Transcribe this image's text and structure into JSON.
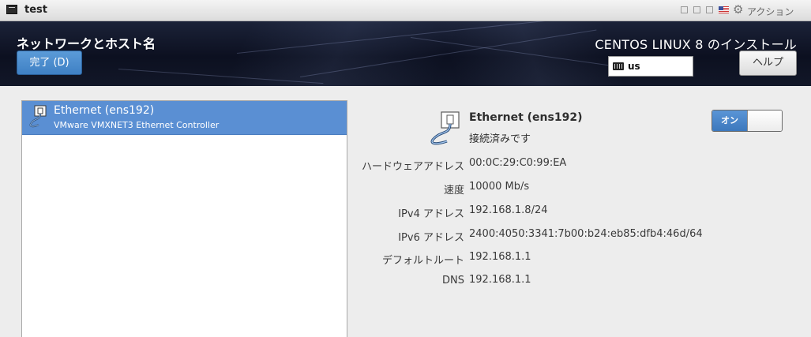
{
  "window": {
    "title": "test",
    "action_label": "アクション",
    "icons": [
      "terminal-icon",
      "window-control-icon",
      "flag-icon",
      "gear-icon"
    ]
  },
  "header": {
    "page_title": "ネットワークとホスト名",
    "done_label": "完了 (D)",
    "install_title": "CENTOS LINUX 8 のインストール",
    "keyboard_layout": "us",
    "help_label": "ヘルプ"
  },
  "device_list": {
    "items": [
      {
        "name": "Ethernet (ens192)",
        "description": "VMware VMXNET3 Ethernet Controller",
        "selected": true,
        "icon": "network-wired-icon"
      }
    ]
  },
  "details": {
    "name": "Ethernet (ens192)",
    "status": "接続済みです",
    "toggle_label": "オン",
    "toggle_state": true,
    "rows": [
      {
        "label": "ハードウェアアドレス",
        "value": "00:0C:29:C0:99:EA"
      },
      {
        "label": "速度",
        "value": "10000 Mb/s"
      },
      {
        "label": "IPv4 アドレス",
        "value": "192.168.1.8/24"
      },
      {
        "label": "IPv6 アドレス",
        "value": "2400:4050:3341:7b00:b24:eb85:dfb4:46d/64"
      },
      {
        "label": "デフォルトルート",
        "value": "192.168.1.1"
      },
      {
        "label": "DNS",
        "value": "192.168.1.1"
      }
    ]
  },
  "colors": {
    "accent": "#3f80c4",
    "selection": "#5a8fd3",
    "header_bg": "#0c1020"
  }
}
